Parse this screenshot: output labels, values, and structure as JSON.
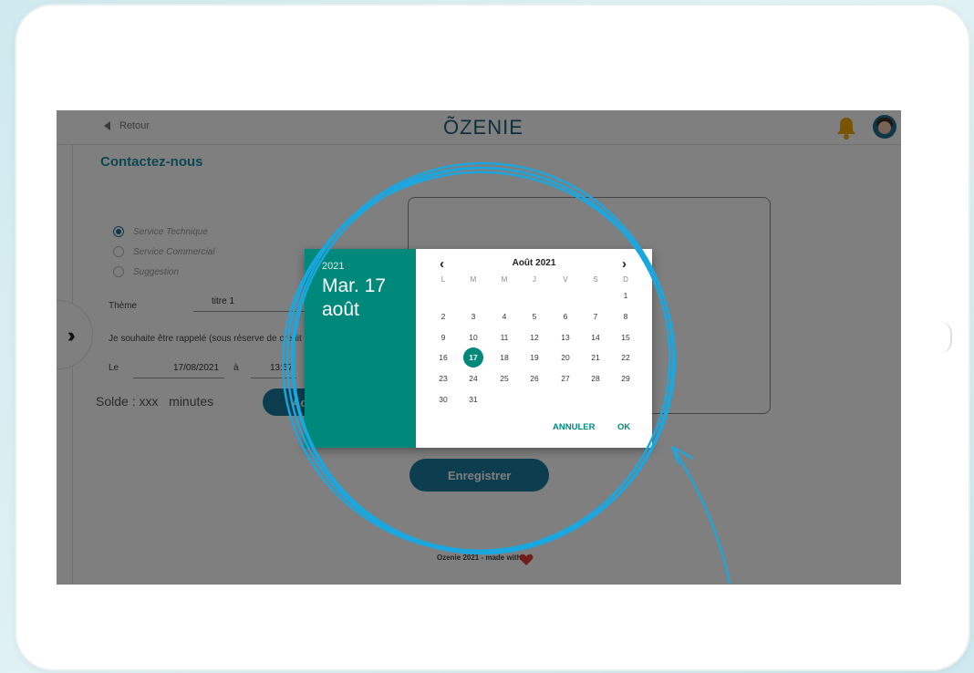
{
  "app": {
    "back_label": "Retour",
    "logo": "ÕZENIE",
    "page_title": "Contactez-nous"
  },
  "form": {
    "radios": [
      {
        "label": "Service Technique",
        "selected": true
      },
      {
        "label": "Service Commercial",
        "selected": false
      },
      {
        "label": "Suggestion",
        "selected": false
      }
    ],
    "theme_label": "Thème",
    "theme_value": "titre 1",
    "callback_text": "Je souhaite être rappelé (sous réserve de crédit t",
    "date_label": "Le",
    "date_value": "17/08/2021",
    "time_sep": "à",
    "time_value": "13:57",
    "solde_label": "Solde :",
    "solde_value": "xxx",
    "solde_unit": "minutes",
    "buy_button_label": "Ach",
    "save_button_label": "Enregistrer",
    "footer_text": "Ozenie 2021 - made with"
  },
  "datepicker": {
    "year": "2021",
    "selected_date": "Mar. 17 août",
    "month_label": "Août 2021",
    "weekdays": [
      "L",
      "M",
      "M",
      "J",
      "V",
      "S",
      "D"
    ],
    "weeks": [
      [
        "",
        "",
        "",
        "",
        "",
        "",
        "1"
      ],
      [
        "2",
        "3",
        "4",
        "5",
        "6",
        "7",
        "8"
      ],
      [
        "9",
        "10",
        "11",
        "12",
        "13",
        "14",
        "15"
      ],
      [
        "16",
        "17",
        "18",
        "19",
        "20",
        "21",
        "22"
      ],
      [
        "23",
        "24",
        "25",
        "26",
        "27",
        "28",
        "29"
      ],
      [
        "30",
        "31",
        "",
        "",
        "",
        "",
        ""
      ]
    ],
    "selected_day": "17",
    "cancel_label": "ANNULER",
    "ok_label": "OK",
    "prev_icon": "‹",
    "next_icon": "›"
  },
  "colors": {
    "accent": "#00897b",
    "brand": "#1b8ea3",
    "highlight_circle": "#1aa7e0"
  }
}
